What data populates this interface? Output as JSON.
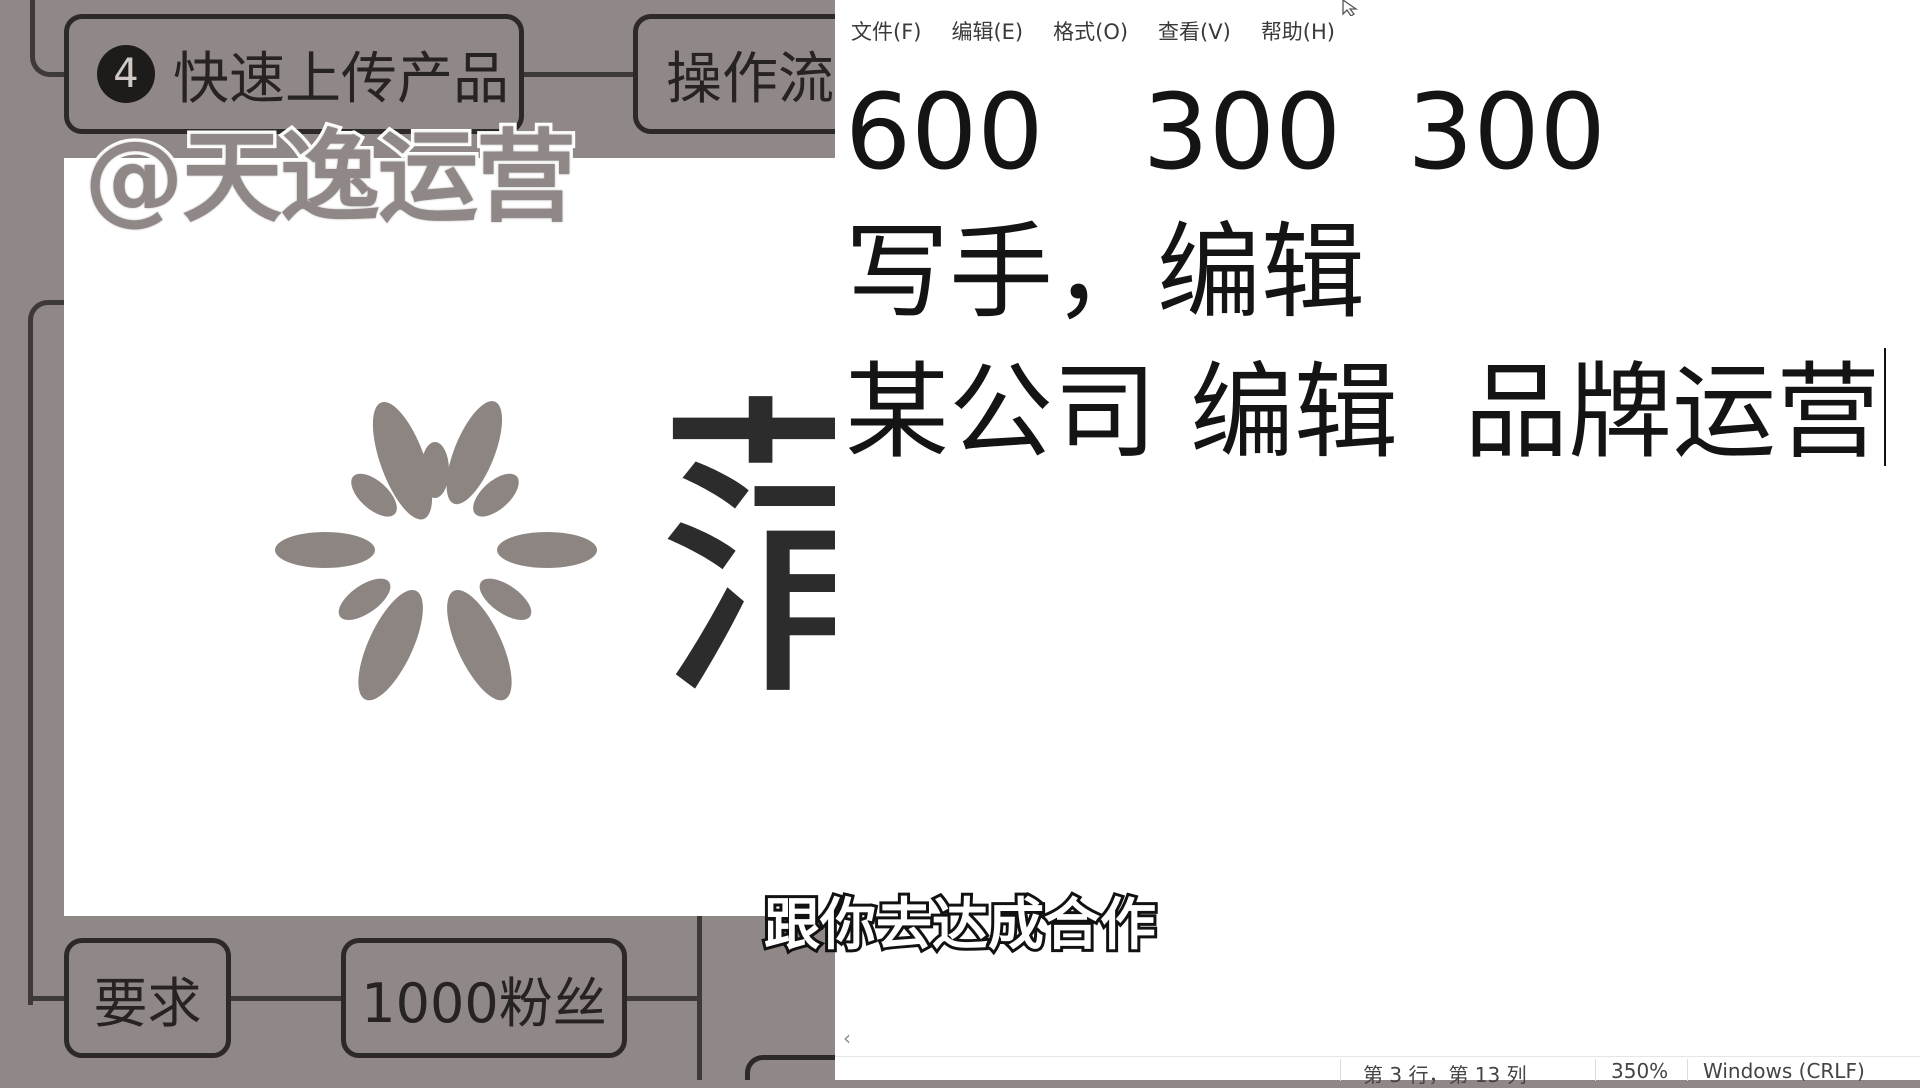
{
  "video": {
    "watermark": "@天逸运营",
    "subtitle": "跟你去达成合作",
    "mindmap": {
      "upload_node": {
        "badge": "4",
        "label": "快速上传产品"
      },
      "flow_node": {
        "label": "操作流程"
      },
      "requirement_node": {
        "label": "要求"
      },
      "fans_node": {
        "label": "1000粉丝"
      }
    },
    "logo_glyph": "蒲"
  },
  "notepad": {
    "menu": [
      "文件(F)",
      "编辑(E)",
      "格式(O)",
      "查看(V)",
      "帮助(H)"
    ],
    "lines": [
      "600   300  300",
      "写手，编辑",
      "某公司 编辑  品牌运营"
    ],
    "status": {
      "position": "第 3 行，第 13 列",
      "zoom": "350%",
      "line_ending": "Windows (CRLF)"
    }
  },
  "colors": {
    "mindmap_bg": "#8f8886",
    "logo_gray": "#8d8582",
    "node_border": "#2c2928"
  }
}
